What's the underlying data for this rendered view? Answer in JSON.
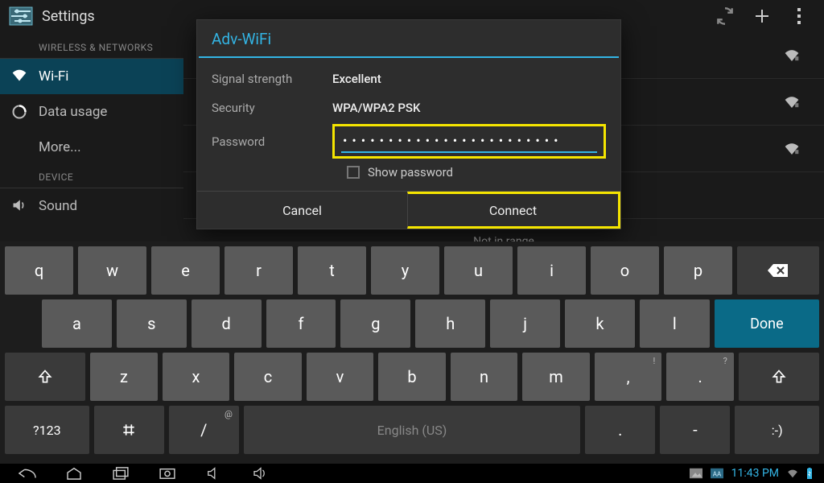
{
  "actionbar": {
    "title": "Settings"
  },
  "sidebar": {
    "section_wireless": "WIRELESS & NETWORKS",
    "section_device": "DEVICE",
    "items": {
      "wifi": "Wi-Fi",
      "data_usage": "Data usage",
      "more": "More...",
      "sound": "Sound"
    }
  },
  "not_in_range": "Not in range",
  "dialog": {
    "title": "Adv-WiFi",
    "signal_label": "Signal strength",
    "signal_value": "Excellent",
    "security_label": "Security",
    "security_value": "WPA/WPA2 PSK",
    "password_label": "Password",
    "password_value": "••••••••••••••••••••••••",
    "show_password": "Show password",
    "cancel": "Cancel",
    "connect": "Connect"
  },
  "keyboard": {
    "row1": [
      "q",
      "w",
      "e",
      "r",
      "t",
      "y",
      "u",
      "i",
      "o",
      "p"
    ],
    "row2": [
      "a",
      "s",
      "d",
      "f",
      "g",
      "h",
      "j",
      "k",
      "l"
    ],
    "row3": [
      "z",
      "x",
      "c",
      "v",
      "b",
      "n",
      "m",
      ",",
      "."
    ],
    "row3_sup": {
      "comma": "!",
      "period": "?"
    },
    "done": "Done",
    "sym": "?123",
    "slash": "/",
    "slash_sup": "@",
    "space": "English (US)",
    "period2": ".",
    "dash": "-",
    "smiley": ":-)"
  },
  "statusbar": {
    "clock": "11:43 PM"
  }
}
